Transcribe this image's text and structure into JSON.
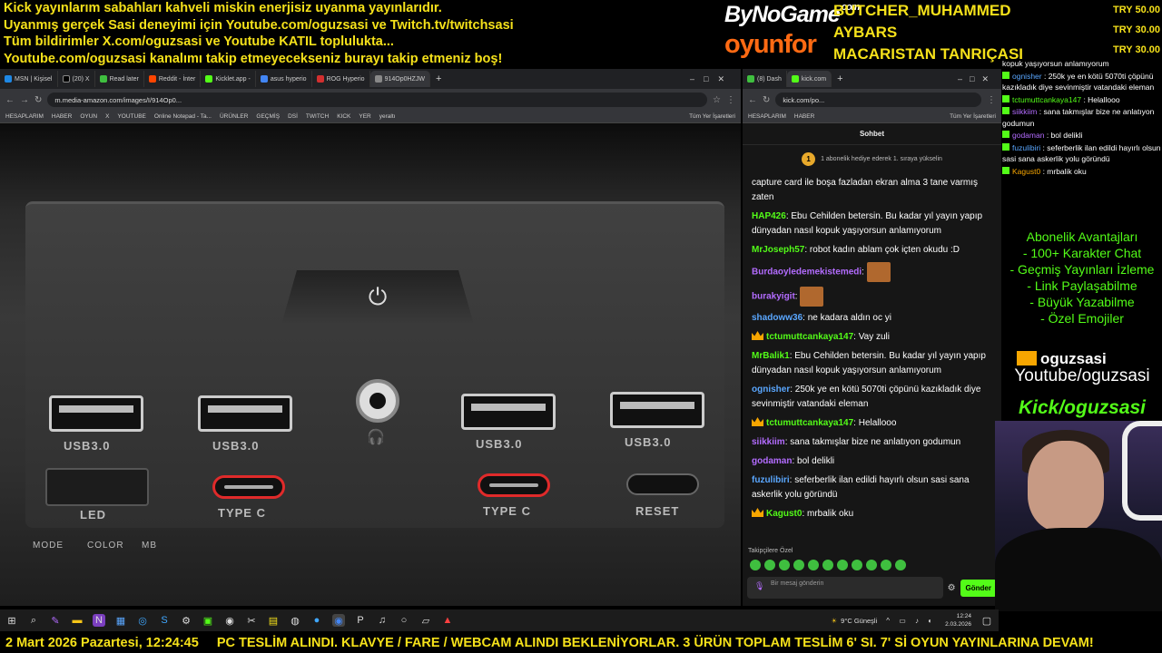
{
  "banner": {
    "lines": [
      "Kick yayınlarım sabahları kahveli miskin enerjisiz uyanma yayınlarıdır.",
      "Uyanmış gerçek Sasi deneyimi için Youtube.com/oguzsasi ve Twitch.tv/twitchsasi",
      "Tüm bildirimler X.com/oguzsasi ve Youtube KATIL toplulukta...",
      "Youtube.com/oguzsasi kanalımı takip etmeyecekseniz burayı takip etmeniz boş!"
    ]
  },
  "sponsors": {
    "bynogame": "ByNoGame",
    "bynogame_tld": ".com",
    "oyunfor": "oyunfor"
  },
  "donors": {
    "names": [
      "BUTCHER_MUHAMMED",
      "AYBARS",
      "MACARISTAN TANRIÇASI"
    ],
    "amounts": [
      "TRY 50.00",
      "TRY 30.00",
      "TRY 30.00"
    ]
  },
  "left_browser": {
    "tabs": [
      "MSN | Kişisel",
      "(20) X",
      "Read later",
      "Reddit - İnter",
      "Kicklet.app -",
      "asus hyperio",
      "ROG Hyperio",
      "914Op0HZJW"
    ],
    "url": "m.media-amazon.com/images/I/914Op0...",
    "bookmarks": [
      "HESAPLARIM",
      "HABER",
      "OYUN",
      "X",
      "YOUTUBE",
      "Online Notepad - Ta...",
      "ÜRÜNLER",
      "GEÇMİŞ",
      "DSİ",
      "TWITCH",
      "KICK",
      "YER",
      "yeraltı",
      "Tüm Yer İşaretleri"
    ]
  },
  "product": {
    "usb_label": "USB3.0",
    "typec_label": "TYPE C",
    "led_label": "LED",
    "reset_label": "RESET",
    "led_modes": [
      "MODE",
      "COLOR",
      "MB"
    ]
  },
  "right_browser": {
    "tabs": [
      "(8) Dash",
      "kick.com"
    ],
    "url": "kick.com/po...",
    "bookmarks": [
      "HESAPLARIM",
      "HABER",
      "Tüm Yer İşaretleri"
    ]
  },
  "chat": {
    "title": "Sohbet",
    "pinned_coin": "1",
    "pinned_text": "1 abonelik hediye ederek 1. sıraya yükselin",
    "messages": [
      {
        "user": "",
        "color": "#ffffff",
        "text": "capture card ile boşa fazladan ekran alma 3 tane varmış zaten",
        "crown": false
      },
      {
        "user": "HAP426",
        "color": "#53fc18",
        "text": "Ebu Cehilden betersin. Bu kadar yıl yayın yapıp dünyadan nasıl kopuk yaşıyorsun anlamıyorum",
        "crown": false
      },
      {
        "user": "MrJoseph57",
        "color": "#53fc18",
        "text": "robot kadın ablam çok içten okudu :D",
        "crown": false
      },
      {
        "user": "Burdaoyledemekistemedi",
        "color": "#b36cff",
        "text": "",
        "crown": false,
        "emote": true
      },
      {
        "user": "burakyigit",
        "color": "#b36cff",
        "text": "",
        "crown": false,
        "emote": true
      },
      {
        "user": "shadoww36",
        "color": "#5aa7ff",
        "text": "ne kadara aldın oc yi",
        "crown": false
      },
      {
        "user": "tctumuttcankaya147",
        "color": "#53fc18",
        "text": "Vay zuli",
        "crown": true
      },
      {
        "user": "MrBalik1",
        "color": "#53fc18",
        "text": "Ebu Cehilden betersin. Bu kadar yıl yayın yapıp dünyadan nasıl kopuk yaşıyorsun anlamıyorum",
        "crown": false
      },
      {
        "user": "ognisher",
        "color": "#5aa7ff",
        "text": "250k ye en kötü 5070ti çöpünü kazıkladık diye sevinmiştir vatandaki eleman",
        "crown": false
      },
      {
        "user": "tctumuttcankaya147",
        "color": "#53fc18",
        "text": "Helallooo",
        "crown": true
      },
      {
        "user": "siikkiim",
        "color": "#b36cff",
        "text": "sana takmışlar bize ne anlatıyon godumun",
        "crown": false
      },
      {
        "user": "godaman",
        "color": "#b36cff",
        "text": "bol delikli",
        "crown": false
      },
      {
        "user": "fuzulibiri",
        "color": "#5aa7ff",
        "text": "seferberlik ilan edildi hayırlı olsun sasi sana askerlik yolu göründü",
        "crown": false
      },
      {
        "user": "Kagust0",
        "color": "#53fc18",
        "text": "mrbalik oku",
        "crown": true
      }
    ],
    "followers_label": "Takipçilere Özel",
    "input_placeholder": "Bir mesaj gönderin",
    "send_label": "Gönder"
  },
  "side_chat": [
    {
      "user": "",
      "text": "kopuk yaşıyorsun anlamıyorum",
      "userColor": "#ffffff"
    },
    {
      "user": "ognisher",
      "text": "250k ye en kötü 5070ti çöpünü kazıkladık diye sevinmiştir vatandaki eleman",
      "userColor": "#5aa7ff"
    },
    {
      "user": "tctumuttcankaya147",
      "text": "Helallooo",
      "userColor": "#53fc18"
    },
    {
      "user": "siikkiim",
      "text": "sana takmışlar bize ne anlatıyon godumun",
      "userColor": "#b36cff"
    },
    {
      "user": "godaman",
      "text": "bol delikli",
      "userColor": "#b36cff"
    },
    {
      "user": "fuzulibiri",
      "text": "seferberlik ilan edildi hayırlı olsun sasi sana askerlik yolu göründü",
      "userColor": "#5aa7ff"
    },
    {
      "user": "Kagust0",
      "text": "mrbalik oku",
      "userColor": "#f7a600"
    }
  ],
  "perks": {
    "title": "Abonelik Avantajları",
    "items": [
      "- 100+ Karakter Chat",
      "- Geçmiş Yayınları İzleme",
      "- Link Paylaşabilme",
      "- Büyük Yazabilme",
      "- Özel Emojiler"
    ]
  },
  "socials": {
    "youtube": "Youtube/oguzsasi",
    "kick": "Kick/oguzsasi",
    "logo": "oguzsasi"
  },
  "taskbar": {
    "weather": "9°C Güneşli",
    "time": "12:24",
    "date": "2.03.2026"
  },
  "ticker": {
    "date": "2 Mart 2026 Pazartesi, 12:24:45",
    "text": "PC TESLİM ALINDI. KLAVYE / FARE / WEBCAM ALINDI BEKLENİYORLAR. 3 ÜRÜN TOPLAM TESLİM 6' SI. 7' Sİ OYUN YAYINLARINA DEVAM!"
  }
}
